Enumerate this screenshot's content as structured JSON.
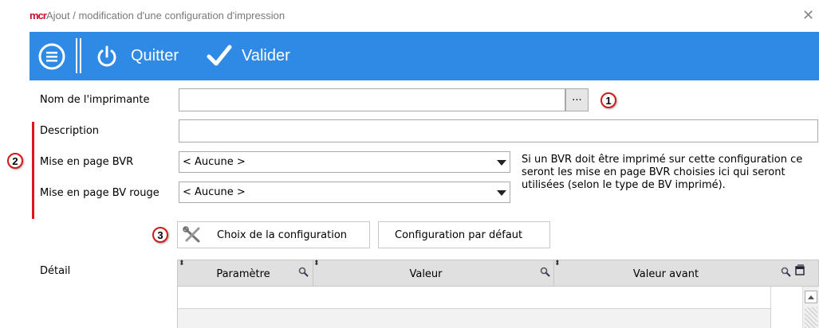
{
  "window": {
    "logo_text": "mcr",
    "title": "Ajout / modification d'une configuration d'impression",
    "close_glyph": "✕"
  },
  "toolbar": {
    "menu_icon": "menu-icon",
    "quit_label": "Quitter",
    "validate_label": "Valider",
    "background_color": "#2f8ae6"
  },
  "form": {
    "printer_name_label": "Nom de l'imprimante",
    "printer_name_value": "",
    "browse_label": "...",
    "description_label": "Description",
    "description_value": "",
    "bvr_layout_label": "Mise en page BVR",
    "bvr_layout_value": "< Aucune >",
    "red_bv_layout_label": "Mise en page BV rouge",
    "red_bv_layout_value": "< Aucune >",
    "info_text": "Si un BVR doit être imprimé sur cette configuration ce seront les mise en page BVR choisies ici qui seront utilisées (selon le type de BV imprimé)."
  },
  "annotations": {
    "badge1": "1",
    "badge2": "2",
    "badge3": "3",
    "accent_color": "#d11a1a"
  },
  "buttons": {
    "choose_config_label": "Choix de la configuration",
    "default_config_label": "Configuration par défaut"
  },
  "detail": {
    "label": "Détail",
    "columns": [
      "Paramètre",
      "Valeur",
      "Valeur avant"
    ],
    "rows": [
      [
        "",
        "",
        ""
      ],
      [
        "",
        "",
        ""
      ]
    ]
  }
}
